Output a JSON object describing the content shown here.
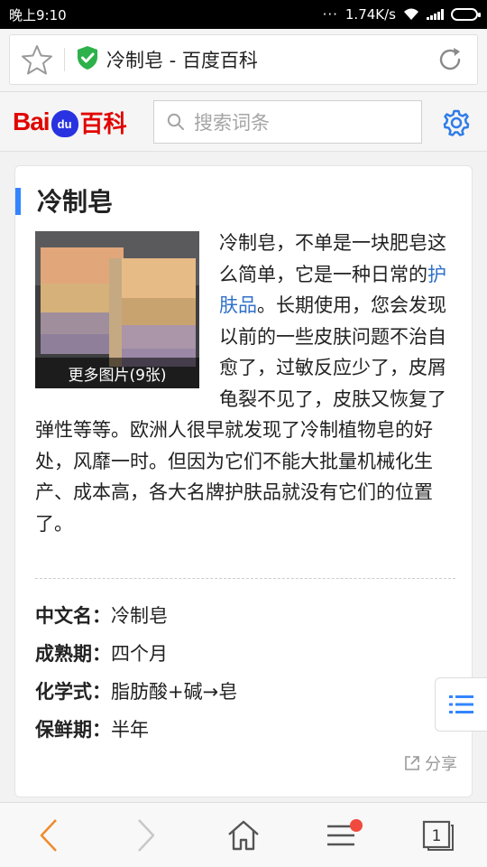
{
  "status_bar": {
    "time": "晚上9:10",
    "dots": "···",
    "speed": "1.74K/s"
  },
  "browser": {
    "page_title": "冷制皂 - 百度百科"
  },
  "header": {
    "logo_text_bai": "Bai",
    "logo_text_du": "du",
    "logo_text_baike": "百科",
    "search_placeholder": "搜索词条"
  },
  "article": {
    "title": "冷制皂",
    "image_caption": "更多图片(9张)",
    "summary_before_link": "冷制皂，不单是一块肥皂这么简单，它是一种日常的",
    "summary_link": "护肤品",
    "summary_after_link": "。长期使用，您会发现以前的一些皮肤问题不治自愈了，过敏反应少了，皮屑龟裂不见了，皮肤又恢复了弹性等等。欧洲人很早就发现了冷制植物皂的好处，风靡一时。但因为它们不能大批量机械化生产、成本高，各大名牌护肤品就没有它们的位置了。",
    "info": [
      {
        "key": "中文名：",
        "value": "冷制皂"
      },
      {
        "key": "成熟期：",
        "value": "四个月"
      },
      {
        "key": "化学式：",
        "value": "脂肪酸+碱→皂"
      },
      {
        "key": "保鲜期：",
        "value": "半年"
      }
    ],
    "share_label": "分享"
  },
  "bottom_nav": {
    "tab_count": "1"
  },
  "colors": {
    "accent_blue": "#3385ff",
    "link_blue": "#3070c8",
    "baidu_red": "#e10601",
    "badge_red": "#f04a3e",
    "shield_green": "#2db14a"
  }
}
